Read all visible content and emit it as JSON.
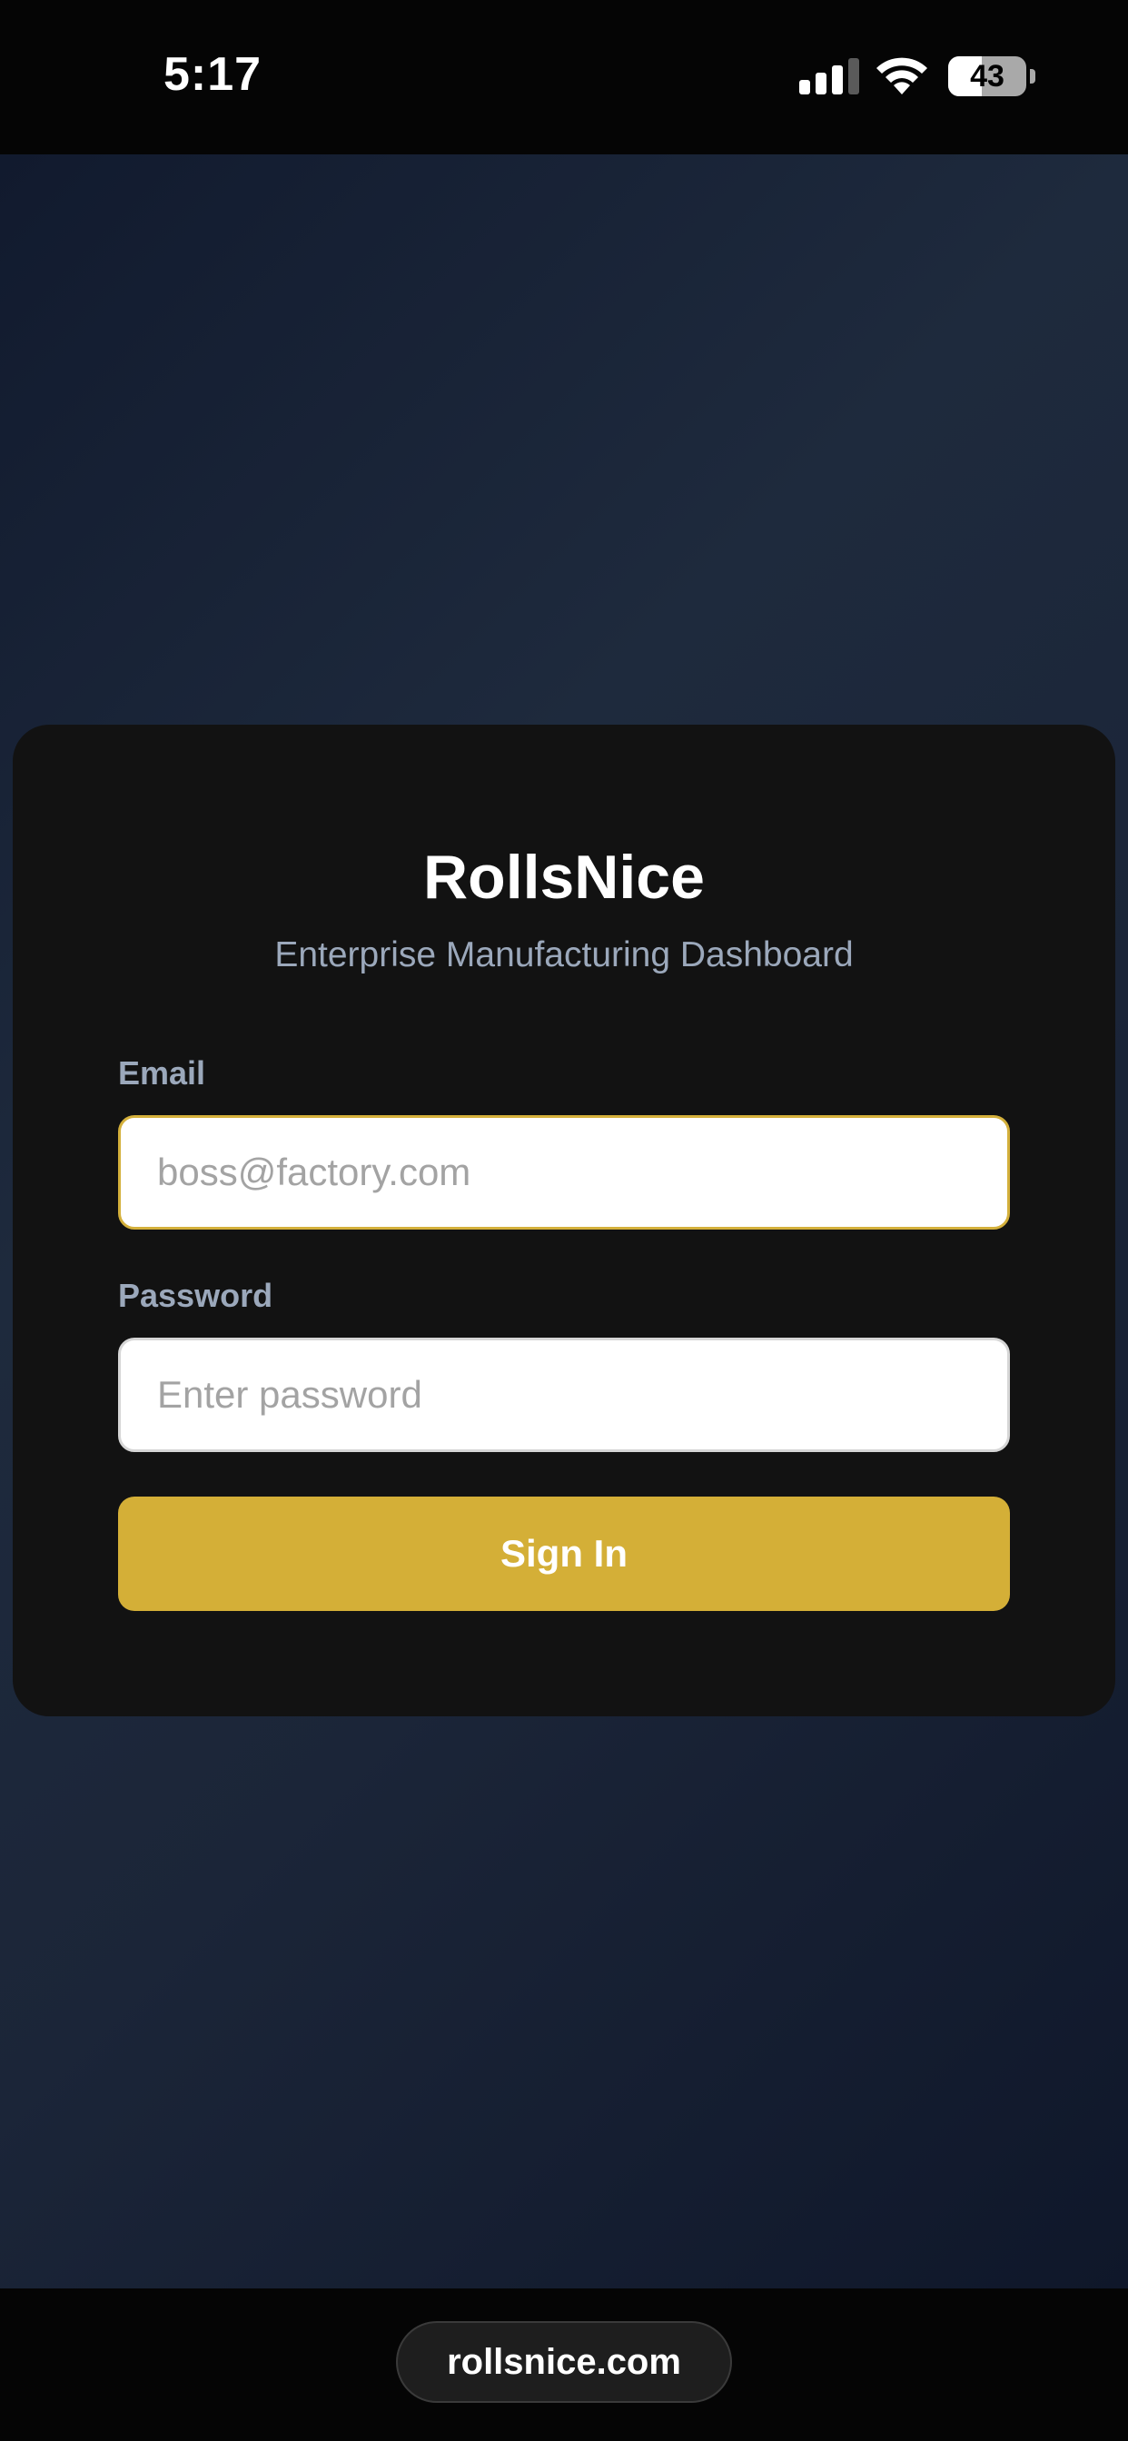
{
  "status_bar": {
    "time": "5:17",
    "battery_level": "43",
    "battery_fraction": 0.43,
    "signal_bars_active": 3,
    "signal_bars_total": 4
  },
  "login": {
    "brand": "RollsNice",
    "subtitle": "Enterprise Manufacturing Dashboard",
    "email_label": "Email",
    "email_placeholder": "boss@factory.com",
    "email_value": "",
    "password_label": "Password",
    "password_placeholder": "Enter password",
    "password_value": "",
    "signin_label": "Sign In"
  },
  "browser": {
    "url": "rollsnice.com"
  },
  "colors": {
    "accent": "#d4af37",
    "card": "#121212",
    "muted_text": "#9ba8bb"
  },
  "icons": {
    "signal": "cellular-signal-icon",
    "wifi": "wifi-icon",
    "battery": "battery-icon"
  }
}
